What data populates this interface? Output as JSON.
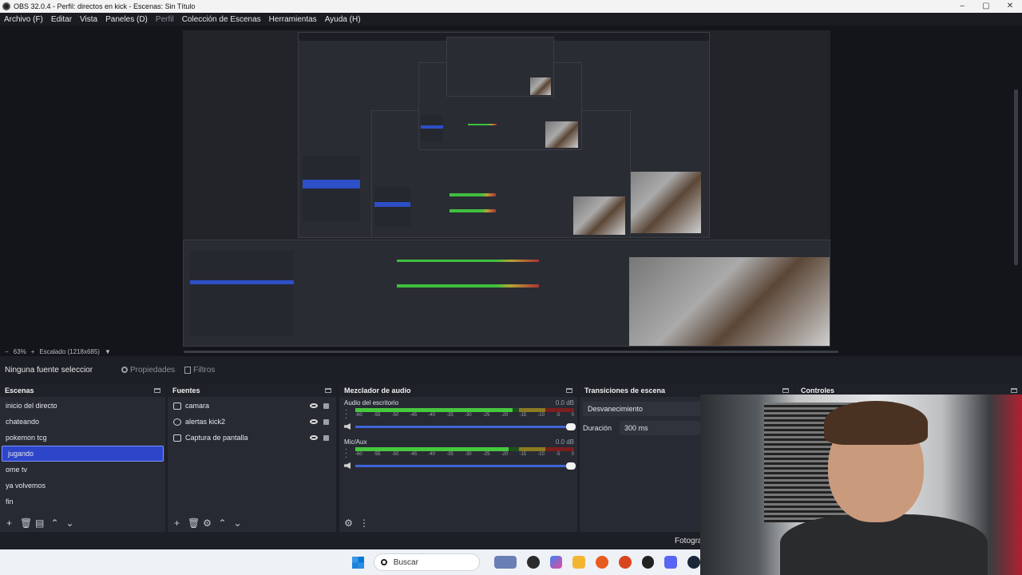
{
  "window": {
    "title": "OBS 32.0.4 - Perfil: directos en kick - Escenas: Sin Título"
  },
  "menu": [
    {
      "label": "Archivo (F)",
      "dim": false
    },
    {
      "label": "Editar",
      "dim": false
    },
    {
      "label": "Vista",
      "dim": false
    },
    {
      "label": "Paneles (D)",
      "dim": false
    },
    {
      "label": "Perfil",
      "dim": true
    },
    {
      "label": "Colección de Escenas",
      "dim": false
    },
    {
      "label": "Herramientas",
      "dim": false
    },
    {
      "label": "Ayuda (H)",
      "dim": false
    }
  ],
  "zoom": {
    "percent": "63%",
    "scale_label": "Escalado (1218x685)"
  },
  "source_toolbar": {
    "selected": "Ninguna fuente seleccionad",
    "properties": "Propiedades",
    "filters": "Filtros"
  },
  "scenes": {
    "title": "Escenas",
    "items": [
      "inicio del directo",
      "chateando",
      "pokemon tcg",
      "jugando",
      "ome tv",
      "ya volvemos",
      "fin"
    ],
    "active_index": 3
  },
  "sources": {
    "title": "Fuentes",
    "items": [
      {
        "label": "camara",
        "icon": "camera-icon"
      },
      {
        "label": "alertas kick2",
        "icon": "browser-icon"
      },
      {
        "label": "Captura de pantalla",
        "icon": "monitor-icon"
      }
    ]
  },
  "mixer": {
    "title": "Mezclador de audio",
    "ticks": [
      "-60",
      "-55",
      "-50",
      "-45",
      "-40",
      "-35",
      "-30",
      "-25",
      "-20",
      "-15",
      "-10",
      "-5",
      "0"
    ],
    "channels": [
      {
        "name": "Audio del escritorio",
        "db": "0.0 dB",
        "level": 0.72
      },
      {
        "name": "Mic/Aux",
        "db": "0.0 dB",
        "level": 0.7
      }
    ]
  },
  "transitions": {
    "title": "Transiciones de escena",
    "type": "Desvanecimiento",
    "duration_label": "Duración",
    "duration_value": "300 ms"
  },
  "controls": {
    "title": "Controles"
  },
  "status": {
    "fps_label": "Fotogra"
  },
  "taskbar": {
    "search_placeholder": "Buscar"
  },
  "colors": {
    "accent": "#2d45c9",
    "meter_green": "#47c73f",
    "background": "#1d1f26"
  }
}
